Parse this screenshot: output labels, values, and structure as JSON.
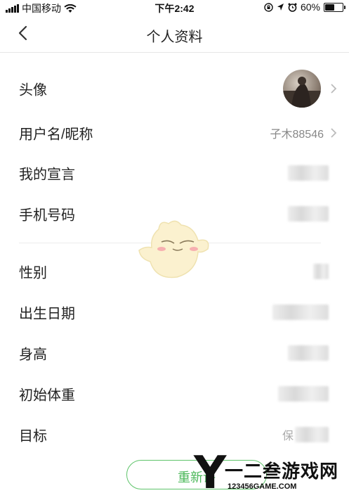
{
  "status_bar": {
    "carrier": "中国移动",
    "time": "下午2:42",
    "battery": "60%",
    "battery_level": 0.6
  },
  "nav": {
    "title": "个人资料",
    "back_icon": "chevron-left-icon"
  },
  "rows": [
    {
      "label": "头像",
      "value": ""
    },
    {
      "label": "用户名/昵称",
      "value": "子木88546"
    },
    {
      "label": "我的宣言",
      "value": ""
    },
    {
      "label": "手机号码",
      "value": ""
    },
    {
      "label": "性别",
      "value": ""
    },
    {
      "label": "出生日期",
      "value": ""
    },
    {
      "label": "身高",
      "value": ""
    },
    {
      "label": "初始体重",
      "value": ""
    },
    {
      "label": "目标",
      "value": "保"
    }
  ],
  "button": {
    "label": "重新评"
  },
  "watermark": {
    "title": "一二叁游戏网",
    "url": "123456GAME.COM"
  },
  "colors": {
    "accent": "#5ec46a",
    "label": "#222222",
    "value": "#888888"
  }
}
